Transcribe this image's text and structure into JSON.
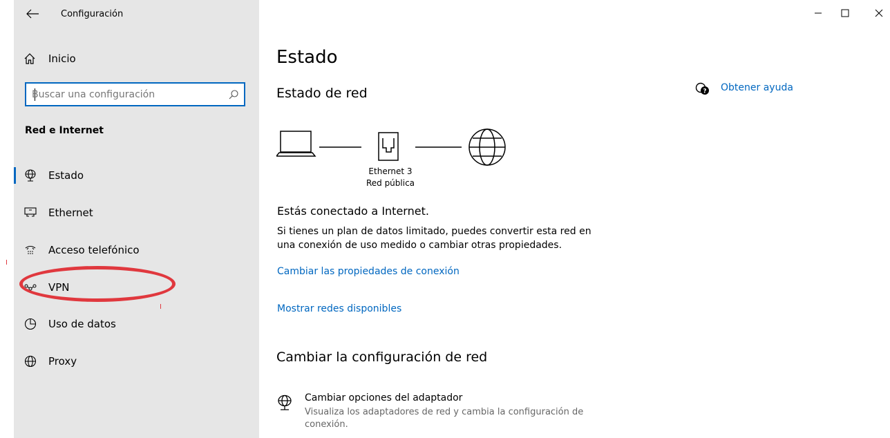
{
  "window": {
    "title": "Configuración",
    "controls": [
      "minimize-icon",
      "maximize-icon",
      "close-icon"
    ]
  },
  "sidebar": {
    "home_label": "Inicio",
    "search": {
      "placeholder": "Buscar una configuración",
      "value": ""
    },
    "section_title": "Red e Internet",
    "items": [
      {
        "label": "Estado",
        "icon": "globe-network-icon",
        "active": true
      },
      {
        "label": "Ethernet",
        "icon": "ethernet-icon",
        "active": false
      },
      {
        "label": "Acceso telefónico",
        "icon": "dialup-icon",
        "active": false
      },
      {
        "label": "VPN",
        "icon": "vpn-icon",
        "active": false
      },
      {
        "label": "Uso de datos",
        "icon": "data-usage-icon",
        "active": false
      },
      {
        "label": "Proxy",
        "icon": "globe-icon",
        "active": false
      }
    ]
  },
  "main": {
    "title": "Estado",
    "network_status_title": "Estado de red",
    "connection": {
      "name": "Ethernet 3",
      "type": "Red pública"
    },
    "connected_text": "Estás conectado a Internet.",
    "description": "Si tienes un plan de datos limitado, puedes convertir esta red en una conexión de uso medido o cambiar otras propiedades.",
    "link_change_properties": "Cambiar las propiedades de conexión",
    "link_show_networks": "Mostrar redes disponibles",
    "change_settings_title": "Cambiar la configuración de red",
    "adapter": {
      "title": "Cambiar opciones del adaptador",
      "description": "Visualiza los adaptadores de red y cambia la configuración de conexión."
    },
    "help_link": "Obtener ayuda"
  },
  "colors": {
    "accent": "#0067c0",
    "sidebar_bg": "#e6e6e6",
    "annotation": "#e0383e"
  }
}
